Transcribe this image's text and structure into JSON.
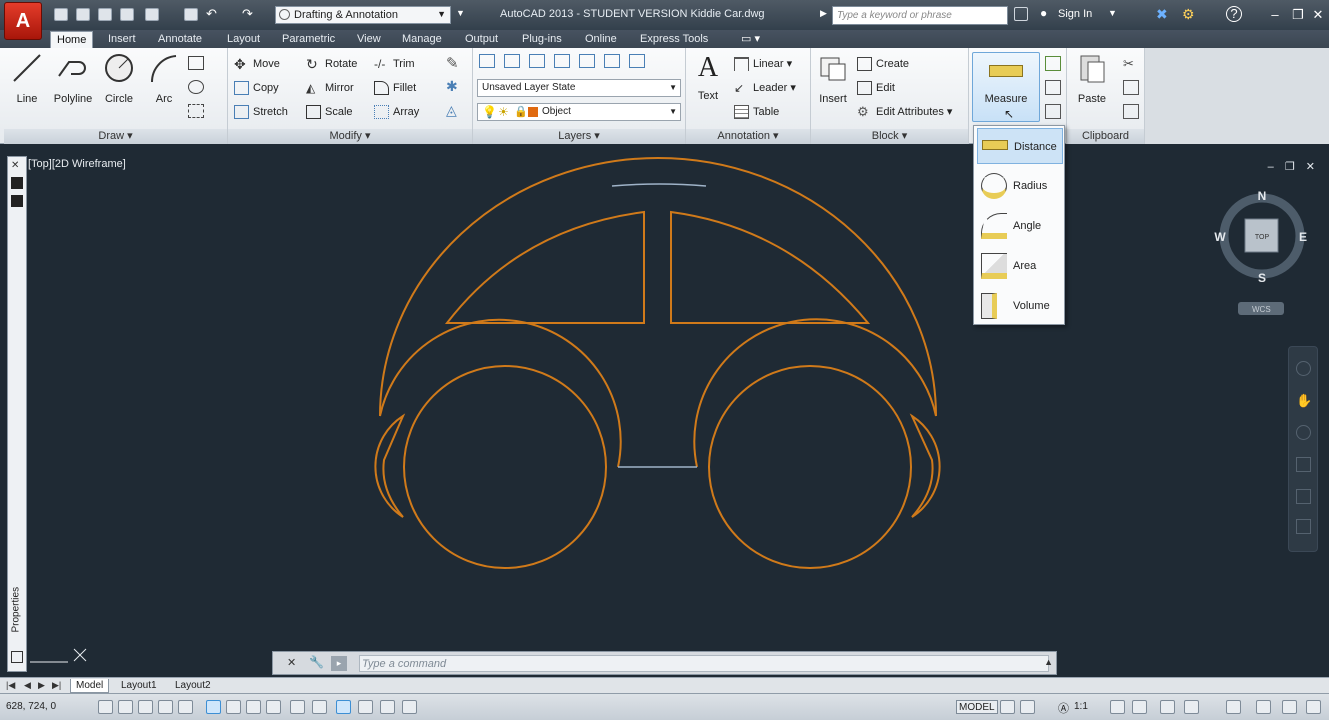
{
  "titlebar": {
    "app_letter": "A",
    "workspace": "Drafting & Annotation",
    "title": "AutoCAD 2013 - STUDENT VERSION    Kiddie Car.dwg",
    "search_placeholder": "Type a keyword or phrase",
    "sign_in": "Sign In"
  },
  "tabs": [
    "Home",
    "Insert",
    "Annotate",
    "Layout",
    "Parametric",
    "View",
    "Manage",
    "Output",
    "Plug-ins",
    "Online",
    "Express Tools"
  ],
  "draw": {
    "title": "Draw ▾",
    "line": "Line",
    "polyline": "Polyline",
    "circle": "Circle",
    "arc": "Arc"
  },
  "modify": {
    "title": "Modify ▾",
    "move": "Move",
    "rotate": "Rotate",
    "trim": "Trim",
    "copy": "Copy",
    "mirror": "Mirror",
    "fillet": "Fillet",
    "stretch": "Stretch",
    "scale": "Scale",
    "array": "Array"
  },
  "layers": {
    "title": "Layers ▾",
    "state": "Unsaved Layer State",
    "layer": "Object"
  },
  "annotation": {
    "title": "Annotation ▾",
    "text": "Text",
    "linear": "Linear",
    "leader": "Leader",
    "table": "Table"
  },
  "block": {
    "title": "Block ▾",
    "insert": "Insert",
    "create": "Create",
    "edit": "Edit",
    "edit_attributes": "Edit Attributes"
  },
  "utilities": {
    "measure": "Measure"
  },
  "clipboard": {
    "title": "Clipboard",
    "paste": "Paste"
  },
  "measure_menu": [
    "Distance",
    "Radius",
    "Angle",
    "Area",
    "Volume"
  ],
  "viewport": {
    "label": "[Top][2D Wireframe]"
  },
  "viewcube": {
    "n": "N",
    "s": "S",
    "e": "E",
    "w": "W",
    "top": "TOP",
    "wcs": "WCS"
  },
  "palette": {
    "label": "Properties"
  },
  "command": {
    "placeholder": "Type a command"
  },
  "layouts": [
    "Model",
    "Layout1",
    "Layout2"
  ],
  "status": {
    "coords": "628, 724, 0",
    "model": "MODEL",
    "scale": "1:1"
  },
  "colors": {
    "drawing": "#d07a1a",
    "background": "#1f2a34",
    "accent": "#3d8fd4"
  }
}
